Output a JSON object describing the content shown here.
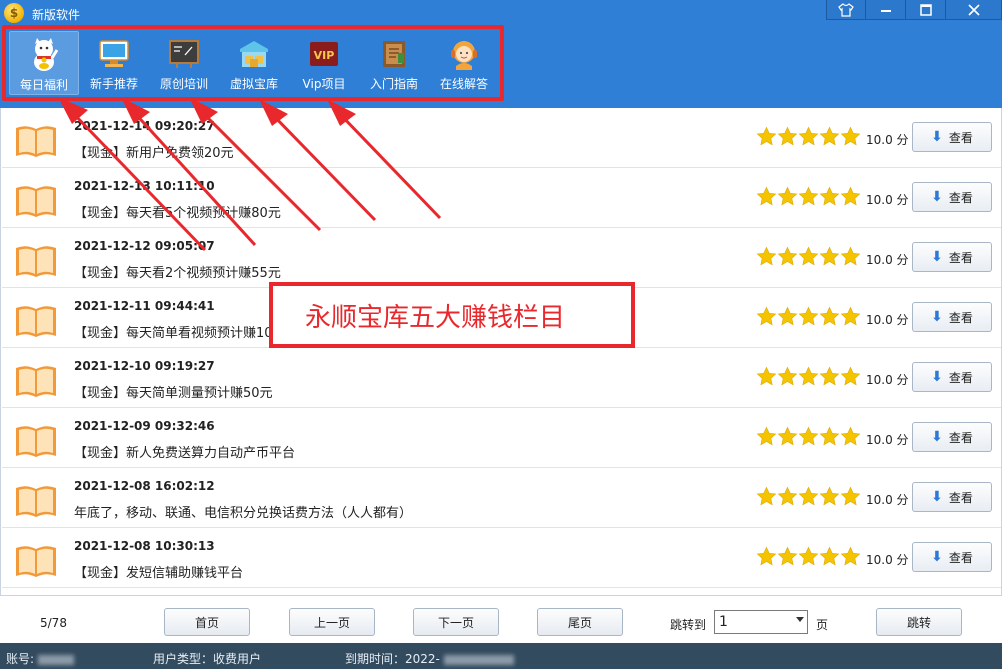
{
  "window": {
    "title": "新版软件",
    "controls": [
      "skin",
      "minimize",
      "maximize",
      "close"
    ]
  },
  "toolbar": {
    "items": [
      {
        "label": "每日福利",
        "icon": "lucky-cat-icon",
        "active": true
      },
      {
        "label": "新手推荐",
        "icon": "monitor-icon",
        "active": false
      },
      {
        "label": "原创培训",
        "icon": "blackboard-icon",
        "active": false
      },
      {
        "label": "虚拟宝库",
        "icon": "warehouse-icon",
        "active": false
      },
      {
        "label": "Vip项目",
        "icon": "vip-badge-icon",
        "active": false
      },
      {
        "label": "入门指南",
        "icon": "guide-book-icon",
        "active": false
      },
      {
        "label": "在线解答",
        "icon": "support-agent-icon",
        "active": false
      }
    ]
  },
  "overlay": {
    "text": "永顺宝库五大赚钱栏目",
    "color": "#e8282c"
  },
  "list": {
    "items": [
      {
        "date": "2021-12-14 09:20:27",
        "title": "【现金】新用户免费领20元",
        "score": "10.0 分",
        "button": "查看"
      },
      {
        "date": "2021-12-13 10:11:10",
        "title": "【现金】每天看5个视频预计赚80元",
        "score": "10.0 分",
        "button": "查看"
      },
      {
        "date": "2021-12-12 09:05:07",
        "title": "【现金】每天看2个视频预计赚55元",
        "score": "10.0 分",
        "button": "查看"
      },
      {
        "date": "2021-12-11 09:44:41",
        "title": "【现金】每天简单看视频预计赚10多元",
        "score": "10.0 分",
        "button": "查看"
      },
      {
        "date": "2021-12-10 09:19:27",
        "title": "【现金】每天简单测量预计赚50元",
        "score": "10.0 分",
        "button": "查看"
      },
      {
        "date": "2021-12-09 09:32:46",
        "title": "【现金】新人免费送算力自动产币平台",
        "score": "10.0 分",
        "button": "查看"
      },
      {
        "date": "2021-12-08 16:02:12",
        "title": "年底了，移动、联通、电信积分兑换话费方法（人人都有）",
        "score": "10.0 分",
        "button": "查看"
      },
      {
        "date": "2021-12-08 10:30:13",
        "title": "【现金】发短信辅助赚钱平台",
        "score": "10.0 分",
        "button": "查看"
      }
    ],
    "stars_per_item": 5,
    "star_color": "#f5c400"
  },
  "pager": {
    "page_info": "5/78",
    "first": "首页",
    "prev": "上一页",
    "next": "下一页",
    "last": "尾页",
    "jump_label": "跳转到",
    "jump_value": "1",
    "page_unit": "页",
    "jump_button": "跳转"
  },
  "status": {
    "account_label": "账号:",
    "user_type": "用户类型：收费用户",
    "expire_label": "到期时间：2022-"
  },
  "colors": {
    "titlebar": "#2f7fd6",
    "statusbar": "#334b5f",
    "highlight": "#e8282c"
  }
}
